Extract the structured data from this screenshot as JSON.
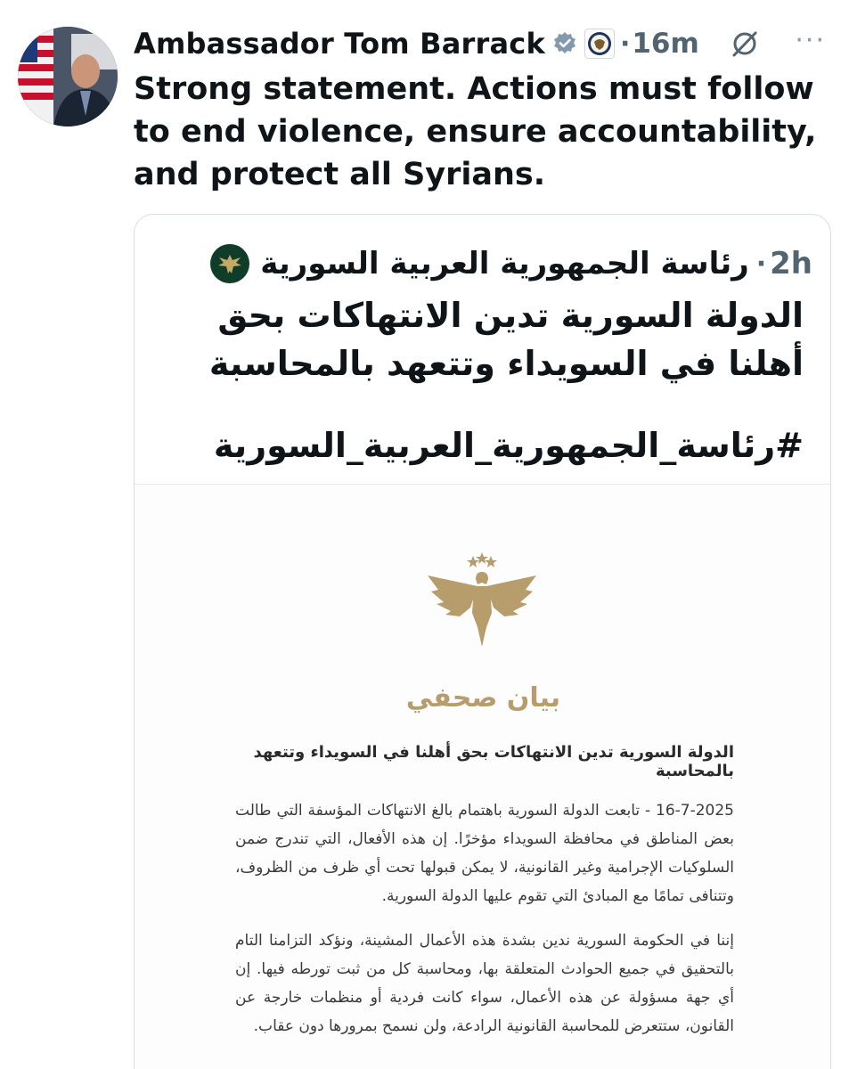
{
  "tweet": {
    "author_name": "Ambassador Tom Barrack",
    "separator": "·",
    "time": "16m",
    "more": "···",
    "text": "Strong statement. Actions must follow to end violence, ensure accountability, and protect all Syrians."
  },
  "quote": {
    "author_name": "رئاسة الجمهورية العربية السورية",
    "separator": "·",
    "time": "2h",
    "text": "الدولة السورية تدين الانتهاكات بحق أهلنا في السويداء وتتعهد بالمحاسبة",
    "hashtag": "#رئاسة_الجمهورية_العربية_السورية"
  },
  "document": {
    "heading": "بيان صحفي",
    "title": "الدولة السورية تدين الانتهاكات بحق أهلنا في السويداء وتتعهد بالمحاسبة",
    "paragraph_1": "16-7-2025 - تابعت الدولة السورية باهتمام بالغ الانتهاكات المؤسفة التي طالت بعض المناطق في محافظة السويداء مؤخرًا. إن هذه الأفعال، التي تندرج ضمن السلوكيات الإجرامية وغير القانونية، لا يمكن قبولها تحت أي ظرف من الظروف، وتتنافى تمامًا مع المبادئ التي تقوم عليها الدولة السورية.",
    "paragraph_2": "إننا في الحكومة السورية ندين بشدة هذه الأعمال المشينة، ونؤكد التزامنا التام بالتحقيق في جميع الحوادث المتعلقة بها، ومحاسبة كل من ثبت تورطه فيها. إن أي جهة مسؤولة عن هذه الأعمال، سواء كانت فردية أو منظمات خارجة عن القانون، ستتعرض للمحاسبة القانونية الرادعة، ولن نسمح بمرورها دون عقاب."
  },
  "colors": {
    "verified": "#829aab",
    "gold": "#b79d6b",
    "seal_green": "#0f3d2a",
    "muted": "#536471"
  },
  "icons": [
    "verified-badge-icon",
    "state-department-seal-icon",
    "grok-icon",
    "more-options-icon",
    "syria-eagle-seal-icon",
    "syria-eagle-emblem"
  ]
}
